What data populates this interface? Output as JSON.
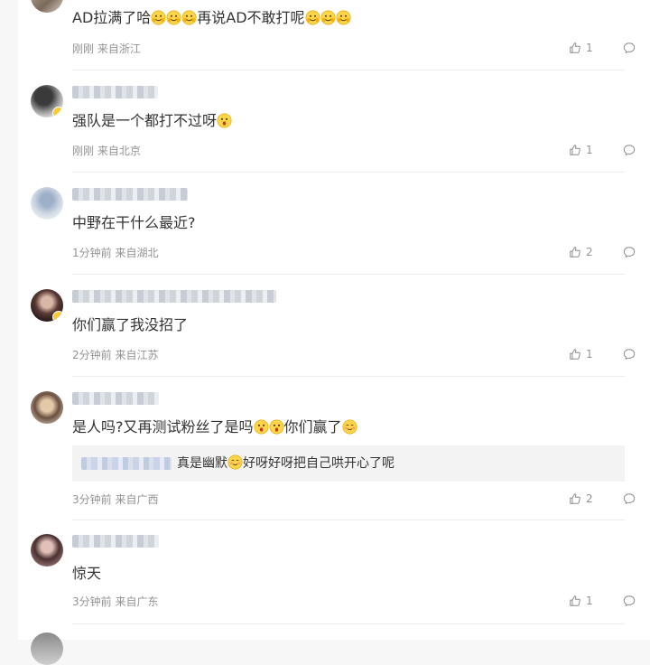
{
  "comments": [
    {
      "text_parts": [
        "AD拉满了哈",
        "再说AD不敢打呢"
      ],
      "time": "刚刚",
      "location": "来自浙江",
      "likes": "1"
    },
    {
      "text_parts": [
        "强队是一个都打不过呀"
      ],
      "time": "刚刚",
      "location": "来自北京",
      "likes": "1"
    },
    {
      "text_parts": [
        "中野在干什么最近?"
      ],
      "time": "1分钟前",
      "location": "来自湖北",
      "likes": "2"
    },
    {
      "text_parts": [
        "你们赢了我没招了"
      ],
      "time": "2分钟前",
      "location": "来自江苏",
      "likes": "1"
    },
    {
      "text_parts": [
        "是人吗?又再测试粉丝了是吗",
        "你们赢了"
      ],
      "time": "3分钟前",
      "location": "来自广西",
      "likes": "2",
      "reply": {
        "text_parts": [
          "真是幽默",
          "好呀好呀把自己哄开心了呢"
        ]
      }
    },
    {
      "text_parts": [
        "惊天"
      ],
      "time": "3分钟前",
      "location": "来自广东",
      "likes": "1"
    }
  ],
  "icons": {
    "like": "thumbs-up-icon",
    "reply": "comment-bubble-icon",
    "emoji_smile": "smile-emoji",
    "emoji_surprised": "surprised-emoji",
    "emoji_blush": "blush-emoji",
    "badge": "verified-badge-icon"
  },
  "colors": {
    "text": "#333333",
    "meta": "#939393",
    "emoji": "#ffc93c",
    "badge": "#ffc933"
  }
}
